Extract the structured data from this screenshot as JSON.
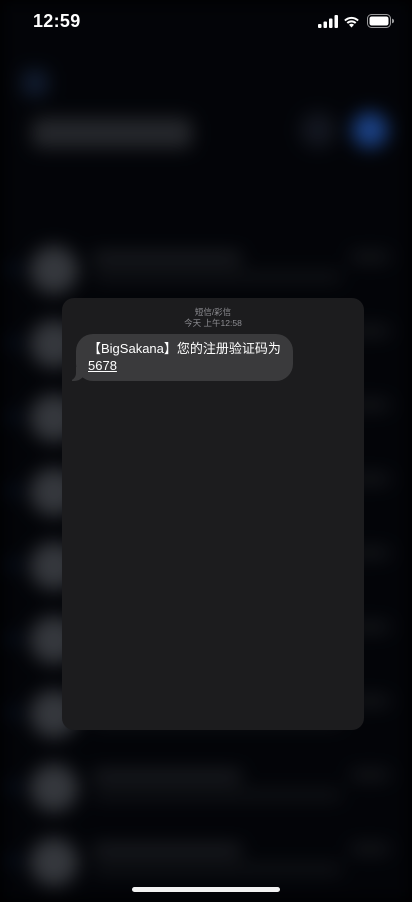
{
  "status_bar": {
    "time": "12:59"
  },
  "preview": {
    "service_label": "短信/彩信",
    "timestamp": "今天 上午12:58",
    "message": {
      "text": "【BigSakana】您的注册验证码为",
      "code": "5678"
    }
  },
  "colors": {
    "card_background": "#1c1c1e",
    "bubble_background": "#3a3a3c",
    "secondary_text": "#8e8e93",
    "accent": "#2a63c9"
  },
  "icons": {
    "signal": "cellular-signal-icon",
    "wifi": "wifi-icon",
    "battery": "battery-icon"
  }
}
